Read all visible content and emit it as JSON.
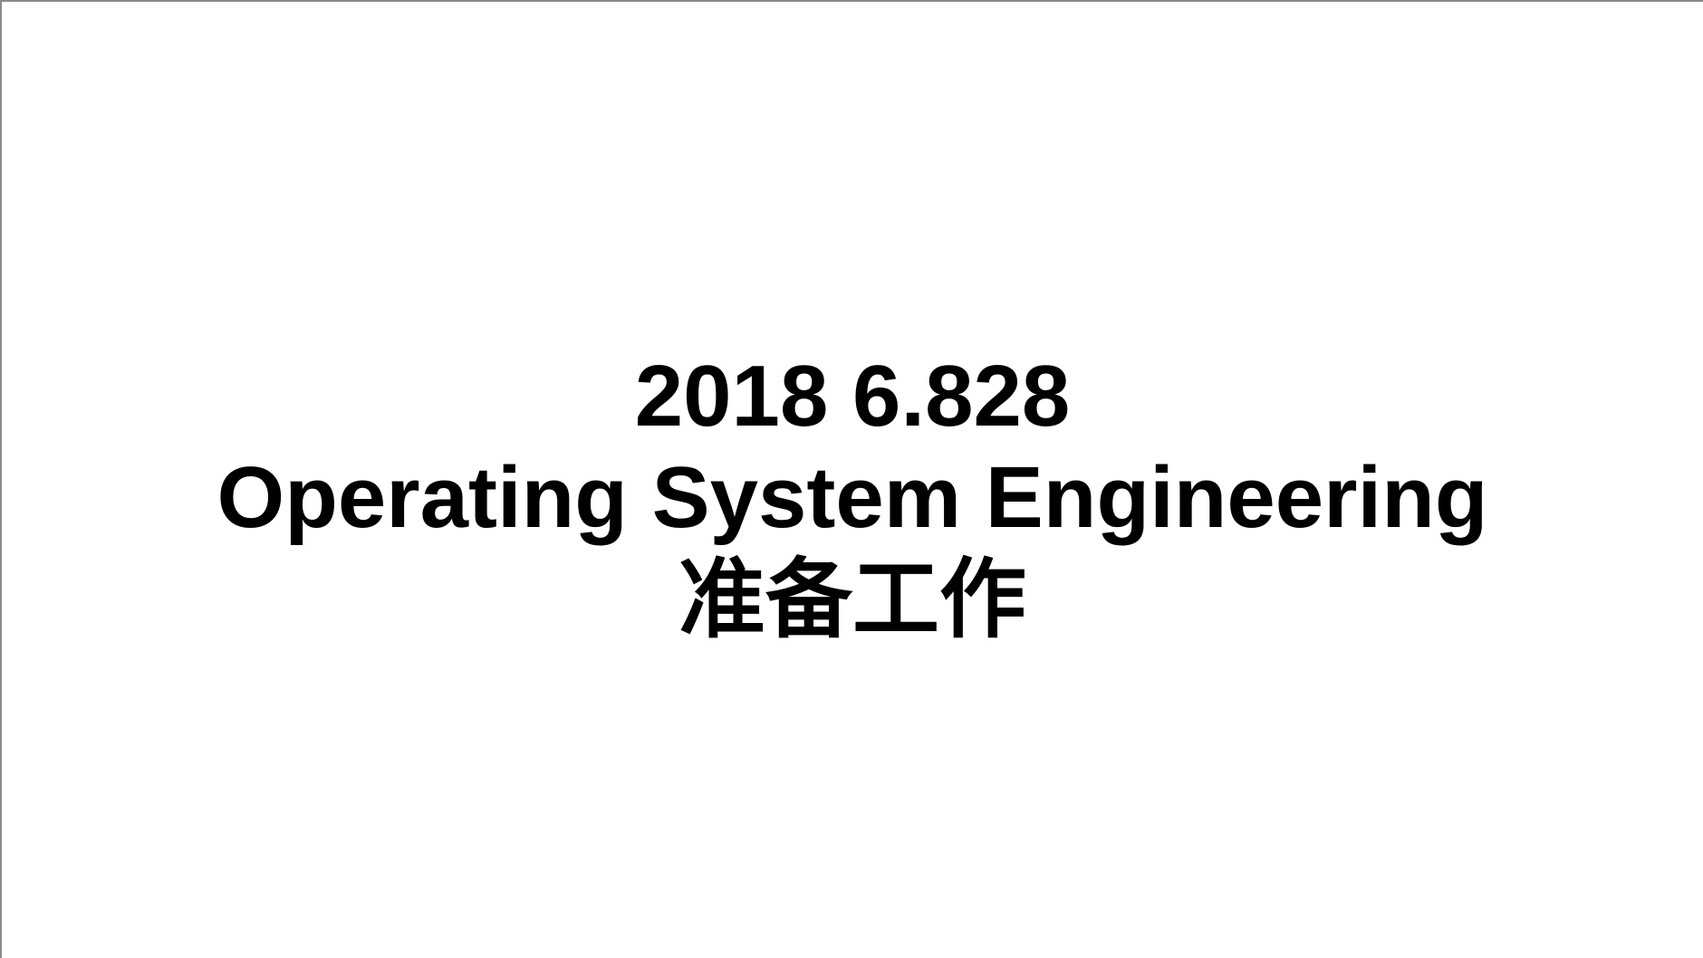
{
  "slide": {
    "title_lines": [
      "2018 6.828",
      "Operating System Engineering",
      "准备工作"
    ]
  },
  "colors": {
    "background": "#ffffff",
    "text": "#000000",
    "frame_border": "#8a8a8a"
  }
}
